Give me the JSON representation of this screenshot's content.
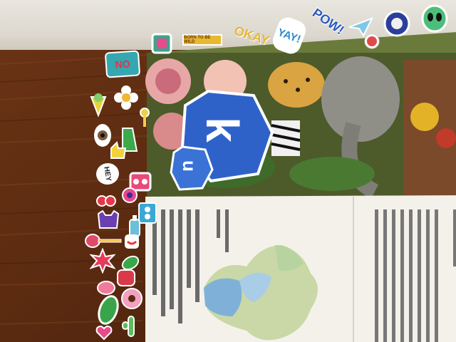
{
  "scene": {
    "description_tags": [
      "wood-table",
      "booklet",
      "stickers"
    ],
    "colors": {
      "wood_dark": "#4a230e",
      "wood_mid": "#7a3d1a",
      "wood_light": "#9a5428",
      "wall": "#e6e3dc",
      "hexagon_blue": "#2f62c9",
      "paper": "#f4f1ea",
      "map_blue": "#8fbfe0",
      "map_green": "#c8d7a8"
    }
  },
  "stickers": {
    "okay": "OKAY",
    "yay": "YAY!",
    "pow": "POW!",
    "hey": "HEY",
    "born_to_be_wild": "BORN TO BE WILD",
    "no": "NO"
  },
  "hexagon": {
    "large_letter": "k",
    "small_letter": "u"
  }
}
